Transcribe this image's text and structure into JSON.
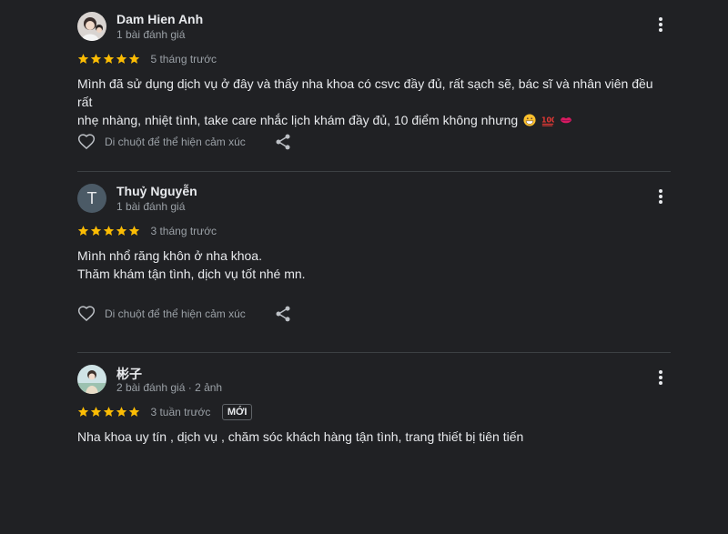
{
  "reviews": [
    {
      "name": "Dam Hien Anh",
      "meta": "1 bài đánh giá",
      "when": "5 tháng trước",
      "rating": 5,
      "text_lines": [
        "Mình đã sử dụng dịch vụ ở đây và thấy nha khoa có csvc đầy đủ, rất sạch sẽ, bác sĩ và nhân viên đều rất",
        "nhẹ nhàng, nhiệt tình, take care nhắc lịch khám đầy đủ, 10 điểm không nhưng"
      ],
      "emojis": [
        "grin-emoji",
        "hundred-emoji",
        "kiss-mark-emoji"
      ],
      "react_label": "Di chuột để thể hiện cảm xúc"
    },
    {
      "name": "Thuỷ Nguyễn",
      "avatar_letter": "T",
      "meta": "1 bài đánh giá",
      "when": "3 tháng trước",
      "rating": 5,
      "text_lines": [
        "Mình nhổ răng khôn ở nha khoa.",
        "Thăm khám tận tình, dịch vụ tốt nhé mn."
      ],
      "react_label": "Di chuột để thể hiện cảm xúc"
    },
    {
      "name": "彬子",
      "meta": "2 bài đánh giá · 2 ảnh",
      "when": "3 tuần trước",
      "badge": "MỚI",
      "rating": 5,
      "text_lines": [
        "Nha khoa uy tín , dịch vụ , chăm sóc khách hàng tận tình, trang thiết bị tiên tiến"
      ]
    }
  ],
  "colors": {
    "star": "#fbbc04",
    "background": "#202124",
    "divider": "#3c4043",
    "text": "#e8eaed",
    "muted": "#9aa0a6"
  }
}
